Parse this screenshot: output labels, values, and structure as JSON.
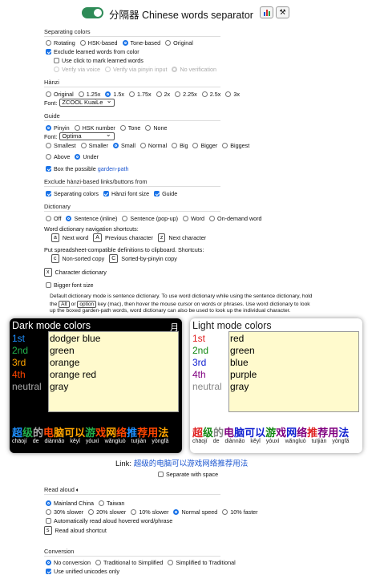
{
  "header": {
    "title": "分隔器 Chinese words separator",
    "stats_icon": "bar-chart-icon",
    "settings_icon": "wrench-icon"
  },
  "separating_colors": {
    "title": "Separating colors",
    "options": [
      "Rotating",
      "HSK-based",
      "Tone-based",
      "Original"
    ],
    "selected": "Tone-based",
    "exclude_learned": "Exclude learned words from color",
    "use_click": "Use click to mark learned words",
    "verify_voice": "Verify via voice",
    "verify_pinyin": "Verify via pinyin input",
    "no_verification": "No verification"
  },
  "hanzi": {
    "title": "Hànzi",
    "sizes": [
      "Original",
      "1.25x",
      "1.5x",
      "1.75x",
      "2x",
      "2.25x",
      "2.5x",
      "3x"
    ],
    "selected": "1.5x",
    "font_label": "Font:",
    "font_value": "ZCOOL KuaiLe"
  },
  "guide": {
    "title": "Guide",
    "types": [
      "Pinyin",
      "HSK number",
      "Tone",
      "None"
    ],
    "selected_type": "Pinyin",
    "font_label": "Font:",
    "font_value": "Optima",
    "sizes": [
      "Smallest",
      "Smaller",
      "Small",
      "Normal",
      "Big",
      "Bigger",
      "Biggest"
    ],
    "selected_size": "Small",
    "positions": [
      "Above",
      "Under"
    ],
    "selected_position": "Under",
    "box_text": "Box the possible",
    "box_link": "garden-path"
  },
  "exclude_links": {
    "title": "Exclude hànzi-based links/buttons from",
    "items": [
      "Separating colors",
      "Hànzi font size",
      "Guide"
    ]
  },
  "dictionary": {
    "title": "Dictionary",
    "options": [
      "Off",
      "Sentence (inline)",
      "Sentence (pop-up)",
      "Word",
      "On-demand word"
    ],
    "selected": "Sentence (inline)",
    "nav_title": "Word dictionary navigation shortcuts:",
    "nav": [
      {
        "key": "a",
        "label": "Next word"
      },
      {
        "key": "A",
        "label": "Previous character"
      },
      {
        "key": "z",
        "label": "Next character"
      }
    ],
    "copy_title": "Put spreadsheet-compatible definitions to clipboard. Shortcuts:",
    "copy": [
      {
        "key": "c",
        "label": "Non-sorted copy"
      },
      {
        "key": "C",
        "label": "Sorted-by-pinyin copy"
      }
    ],
    "char_dict": {
      "key": "x",
      "label": "Character dictionary"
    },
    "bigger_font": "Bigger font size",
    "note_1": "Default dictionary mode is sentence dictionary. To use word dictionary while using the sentence dictionary, hold",
    "note_2a": "the",
    "note_2_alt": "Alt",
    "note_2b": "or",
    "note_2_option": "option",
    "note_2c": "key (mac), then hover the mouse cursor on words or phrases. Use word dictionary to look",
    "note_3": "up the boxed garden-path words, word dictionary can also be used to look up the individual character."
  },
  "dark_panel": {
    "title": "Dark mode colors",
    "corner_char": "月",
    "rows": [
      {
        "name": "1st",
        "value": "dodger blue",
        "color": "#1e90ff"
      },
      {
        "name": "2nd",
        "value": "green",
        "color": "#22b14c"
      },
      {
        "name": "3rd",
        "value": "orange",
        "color": "#ffa500"
      },
      {
        "name": "4th",
        "value": "orange red",
        "color": "#ff4500"
      },
      {
        "name": "neutral",
        "value": "gray",
        "color": "#aaaaaa"
      }
    ]
  },
  "light_panel": {
    "title": "Light mode colors",
    "rows": [
      {
        "name": "1st",
        "value": "red",
        "color": "#e02020"
      },
      {
        "name": "2nd",
        "value": "green",
        "color": "#118811"
      },
      {
        "name": "3rd",
        "value": "blue",
        "color": "#1020d0"
      },
      {
        "name": "4th",
        "value": "purple",
        "color": "#800080"
      },
      {
        "name": "neutral",
        "value": "gray",
        "color": "#888888"
      }
    ]
  },
  "sample": {
    "hanzi": [
      "超级",
      "的",
      "电脑",
      "可以",
      "游戏",
      "网络",
      "推荐",
      "用法"
    ],
    "pinyin": [
      "chāojí",
      "de",
      "diànnǎo",
      "kěyǐ",
      "yóuxì",
      "wǎngluò",
      "tuījiàn",
      "yòngfǎ"
    ]
  },
  "link_line": {
    "label": "Link:",
    "text": "超级的电脑可以游戏网络推荐用法"
  },
  "separate_with_space": "Separate with space",
  "read_aloud": {
    "title": "Read aloud",
    "regions": [
      "Mainland China",
      "Taiwan"
    ],
    "selected_region": "Mainland China",
    "speeds": [
      "30% slower",
      "20% slower",
      "10% slower",
      "Normal speed",
      "10% faster"
    ],
    "selected_speed": "Normal speed",
    "auto_read": "Automatically read aloud hovered word/phrase",
    "shortcut_key": "s",
    "shortcut_label": "Read aloud shortcut"
  },
  "conversion": {
    "title": "Conversion",
    "options": [
      "No conversion",
      "Traditional to Simplified",
      "Simplified to Traditional"
    ],
    "selected": "No conversion",
    "unified": "Use unified unicodes only"
  }
}
